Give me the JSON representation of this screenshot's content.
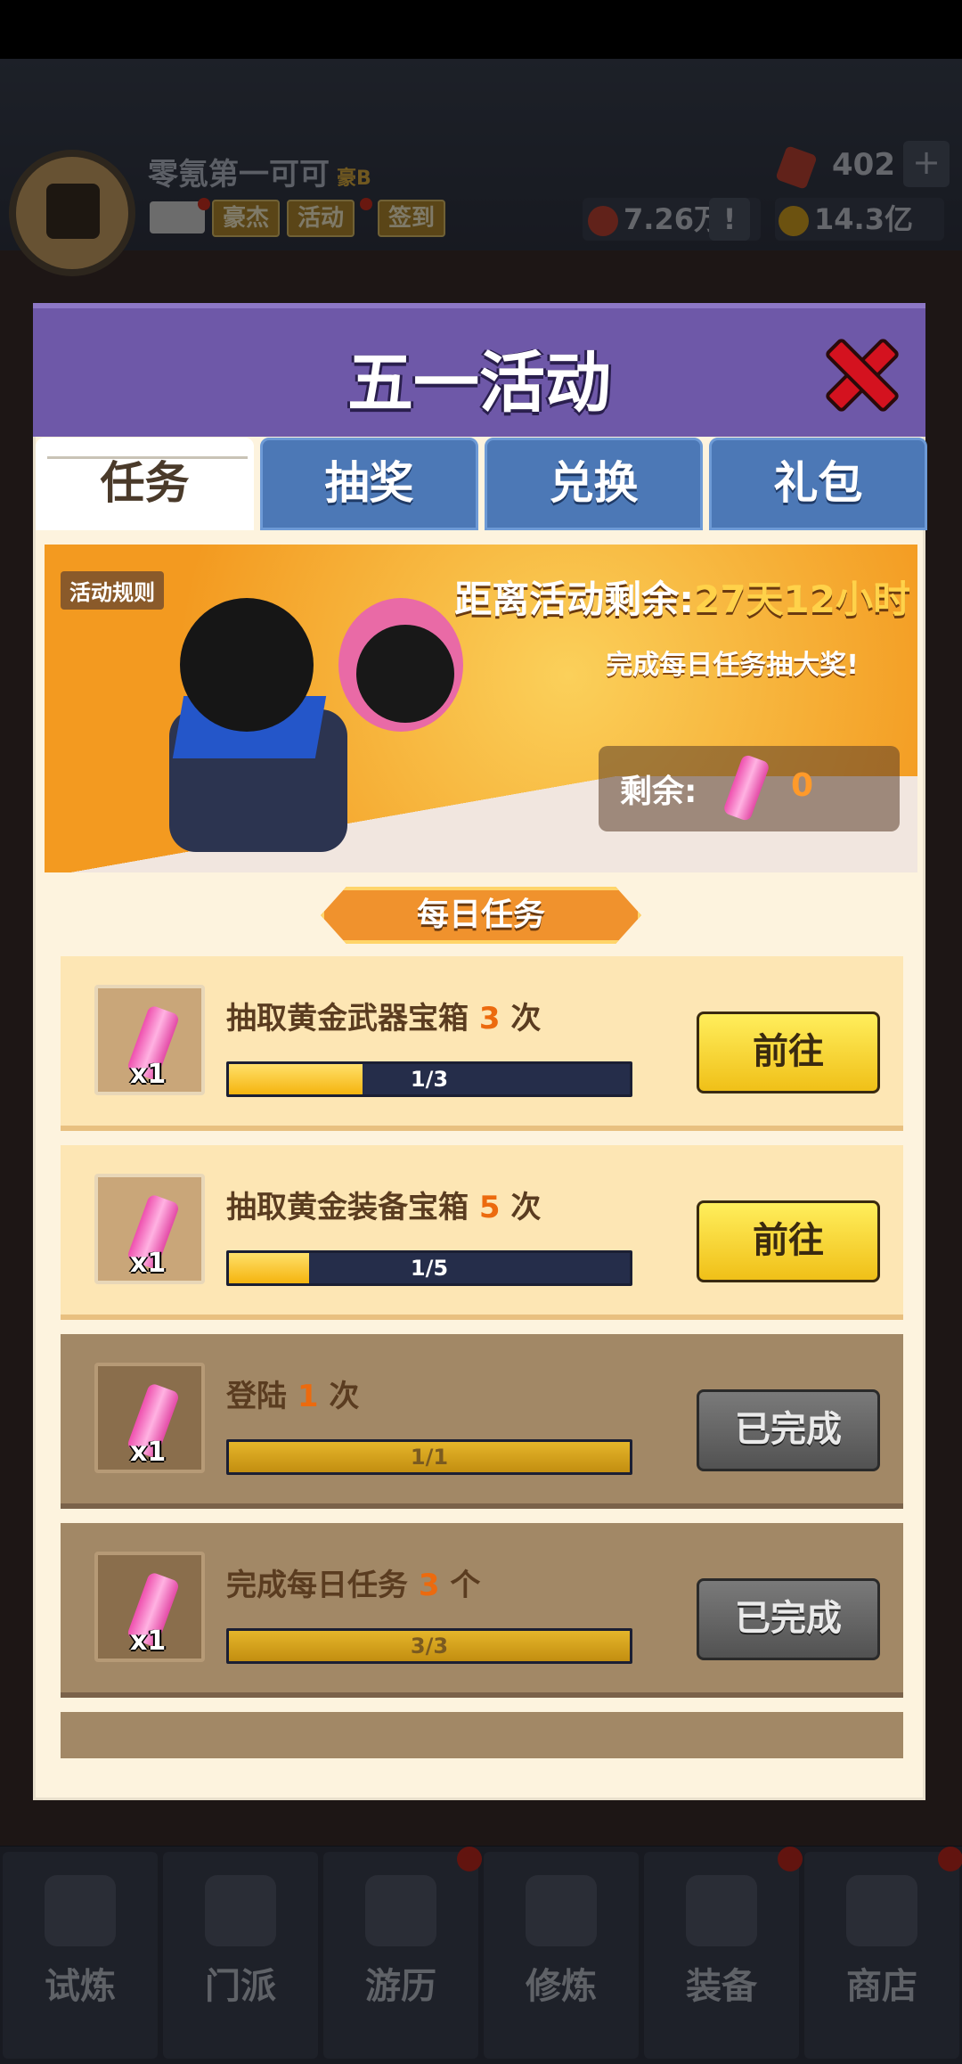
{
  "header": {
    "player_name": "零氪第一可可",
    "player_tag": "豪B",
    "buttons": [
      "豪杰",
      "活动",
      "签到"
    ],
    "gems": "402",
    "plus": "+",
    "resource_1": "7.26万",
    "resource_1_extra": "!",
    "resource_2": "14.3亿"
  },
  "modal": {
    "title": "五一活动",
    "tabs": [
      "任务",
      "抽奖",
      "兑换",
      "礼包"
    ],
    "active_tab": "任务",
    "banner": {
      "rules": "活动规则",
      "countdown_label": "距离活动剩余:",
      "countdown_value": "27天12小时",
      "subtitle": "完成每日任务抽大奖!",
      "remain_label": "剩余:",
      "remain_value": "0"
    },
    "section_title": "每日任务",
    "tasks": [
      {
        "title_pre": "抽取黄金武器宝箱 ",
        "num": "3",
        "title_post": " 次",
        "progress": "1/3",
        "fraction": 0.3333,
        "qty": "x1",
        "button": "前往",
        "done": false
      },
      {
        "title_pre": "抽取黄金装备宝箱 ",
        "num": "5",
        "title_post": " 次",
        "progress": "1/5",
        "fraction": 0.2,
        "qty": "x1",
        "button": "前往",
        "done": false
      },
      {
        "title_pre": "登陆 ",
        "num": "1",
        "title_post": " 次",
        "progress": "1/1",
        "fraction": 1,
        "qty": "x1",
        "button": "已完成",
        "done": true
      },
      {
        "title_pre": "完成每日任务 ",
        "num": "3",
        "title_post": " 个",
        "progress": "3/3",
        "fraction": 1,
        "qty": "x1",
        "button": "已完成",
        "done": true
      }
    ]
  },
  "bottom_nav": [
    "试炼",
    "门派",
    "游历",
    "修炼",
    "装备",
    "商店"
  ],
  "colors": {
    "accent_purple": "#6e58a8",
    "tab_blue": "#4c78b6",
    "orange": "#ec6a0e",
    "yellow_btn": "#f0c018"
  }
}
